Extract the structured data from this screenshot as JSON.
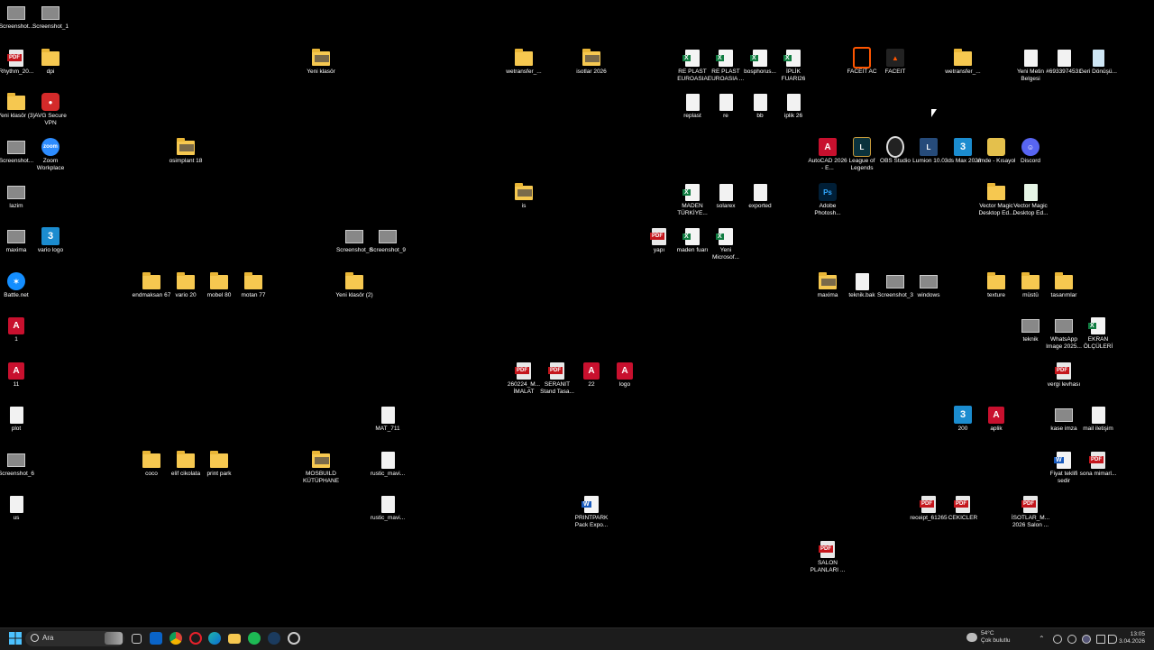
{
  "desktop": {
    "icons": [
      {
        "label": "Screenshot...",
        "type": "shot"
      },
      {
        "label": "Screenshot_1",
        "type": "shot"
      },
      {
        "label": "Rhythm_20...",
        "type": "pdf"
      },
      {
        "label": "dpi",
        "type": "folder"
      },
      {
        "label": "Yeni klasör",
        "type": "folder-pic"
      },
      {
        "label": "wetransfer_...",
        "type": "folder"
      },
      {
        "label": "isotlar 2026",
        "type": "folder-pic"
      },
      {
        "label": "RE PLAST EUROASIA",
        "type": "xls"
      },
      {
        "label": "RE PLAST EUROASIA ...",
        "type": "xls"
      },
      {
        "label": "bosphorus...",
        "type": "xls"
      },
      {
        "label": "İPLİK FUARI26",
        "type": "xls"
      },
      {
        "label": "FACEIT AC",
        "type": "faceit-ac"
      },
      {
        "label": "FACEIT",
        "type": "faceit"
      },
      {
        "label": "wetransfer_...",
        "type": "folder"
      },
      {
        "label": "Yeni Metin Belgesi",
        "type": "doc"
      },
      {
        "label": "#6933974531",
        "type": "doc"
      },
      {
        "label": "Geri Dönüşü...",
        "type": "recycle"
      },
      {
        "label": "Yeni klasör (3)",
        "type": "folder"
      },
      {
        "label": "AVG Secure VPN",
        "type": "avg"
      },
      {
        "label": "replast",
        "type": "doc"
      },
      {
        "label": "re",
        "type": "doc"
      },
      {
        "label": "bb",
        "type": "doc"
      },
      {
        "label": "iplik 26",
        "type": "doc"
      },
      {
        "label": "Screenshot...",
        "type": "shot"
      },
      {
        "label": "Zoom Workplace",
        "type": "zoom"
      },
      {
        "label": "osimplant 18",
        "type": "folder-pic"
      },
      {
        "label": "AutoCAD 2026 - E...",
        "type": "autocad"
      },
      {
        "label": "League of Legends",
        "type": "lol"
      },
      {
        "label": "OBS Studio",
        "type": "obs"
      },
      {
        "label": "Lumion 10.0",
        "type": "lumion"
      },
      {
        "label": "3ds Max 2026",
        "type": "max"
      },
      {
        "label": "vmde - Kısayol",
        "type": "vmde"
      },
      {
        "label": "Discord",
        "type": "discord"
      },
      {
        "label": "lazim",
        "type": "shot"
      },
      {
        "label": "is",
        "type": "folder-pic"
      },
      {
        "label": "MADEN TÜRKİYE...",
        "type": "xls"
      },
      {
        "label": "solarex",
        "type": "doc"
      },
      {
        "label": "exported",
        "type": "doc"
      },
      {
        "label": "Adobe Photosh...",
        "type": "ps"
      },
      {
        "label": "Vector Magic Desktop Ed...",
        "type": "folder"
      },
      {
        "label": "Vector Magic Desktop Ed...",
        "type": "vm"
      },
      {
        "label": "maxima",
        "type": "shot"
      },
      {
        "label": "vario logo",
        "type": "max"
      },
      {
        "label": "Screenshot_8",
        "type": "shot"
      },
      {
        "label": "Screenshot_9",
        "type": "shot"
      },
      {
        "label": "yapı",
        "type": "pdf"
      },
      {
        "label": "maden fuarı",
        "type": "xls"
      },
      {
        "label": "Yeni Microsof...",
        "type": "xls"
      },
      {
        "label": "Battle.net",
        "type": "battle"
      },
      {
        "label": "endmaksan 67",
        "type": "folder"
      },
      {
        "label": "vario 20",
        "type": "folder"
      },
      {
        "label": "mobel 80",
        "type": "folder"
      },
      {
        "label": "motan 77",
        "type": "folder"
      },
      {
        "label": "Yeni klasör (2)",
        "type": "folder"
      },
      {
        "label": "maxima",
        "type": "folder-pic"
      },
      {
        "label": "teknik.bak",
        "type": "doc"
      },
      {
        "label": "Screenshot_3",
        "type": "shot"
      },
      {
        "label": "windows",
        "type": "shot"
      },
      {
        "label": "texture",
        "type": "folder"
      },
      {
        "label": "müstü",
        "type": "folder"
      },
      {
        "label": "tasarımlar",
        "type": "folder"
      },
      {
        "label": "1",
        "type": "fbx"
      },
      {
        "label": "teknik",
        "type": "shot"
      },
      {
        "label": "WhatsApp Image 2025...",
        "type": "shot"
      },
      {
        "label": "EKRAN ÖLÇÜLERİ",
        "type": "xls"
      },
      {
        "label": "11",
        "type": "fbx"
      },
      {
        "label": "260224_M... İMALAT",
        "type": "pdf"
      },
      {
        "label": "SERANIT Stand Tasa...",
        "type": "pdf"
      },
      {
        "label": "22",
        "type": "fbx"
      },
      {
        "label": "logo",
        "type": "fbx"
      },
      {
        "label": "vergi levhası",
        "type": "pdf"
      },
      {
        "label": "plot",
        "type": "doc"
      },
      {
        "label": "MAT_711",
        "type": "doc"
      },
      {
        "label": "200",
        "type": "max"
      },
      {
        "label": "aplik",
        "type": "fbx"
      },
      {
        "label": "kase imza",
        "type": "shot"
      },
      {
        "label": "mail iletişim",
        "type": "doc"
      },
      {
        "label": "Screenshot_6",
        "type": "shot"
      },
      {
        "label": "coco",
        "type": "folder"
      },
      {
        "label": "elif cikolata",
        "type": "folder"
      },
      {
        "label": "print park",
        "type": "folder"
      },
      {
        "label": "MOSBUILD KÜTÜPHANE",
        "type": "folder-pic"
      },
      {
        "label": "rustic_mavi...",
        "type": "doc"
      },
      {
        "label": "Fiyat teklifi sedir",
        "type": "word"
      },
      {
        "label": "sona mimarl...",
        "type": "pdf"
      },
      {
        "label": "us",
        "type": "doc"
      },
      {
        "label": "rustic_mavi...",
        "type": "doc"
      },
      {
        "label": "PRINTPARK Pack Expo...",
        "type": "word"
      },
      {
        "label": "receipt_61265",
        "type": "pdf"
      },
      {
        "label": "CEKICLER",
        "type": "pdf"
      },
      {
        "label": "İSOTLAR_M... 2026 Salon ...",
        "type": "pdf"
      },
      {
        "label": "SALON PLANLARI ...",
        "type": "pdf"
      }
    ]
  },
  "taskbar": {
    "search_placeholder": "Ara",
    "apps": [
      "start-icon",
      "search",
      "widgets-icon",
      "task-view-icon",
      "outlook-icon",
      "opera-icon",
      "chrome-icon",
      "edge-icon",
      "file-explorer-icon",
      "spotify-icon",
      "steam-icon",
      "settings-icon"
    ],
    "weather_temp": "54°C",
    "weather_desc": "Çok bulutlu",
    "time": "13:05",
    "date": "3.04.2026"
  },
  "colors": {
    "accent": "#0078d4",
    "folder": "#f6c850",
    "pdf": "#c4161c",
    "excel": "#107c41",
    "word": "#185abd"
  }
}
